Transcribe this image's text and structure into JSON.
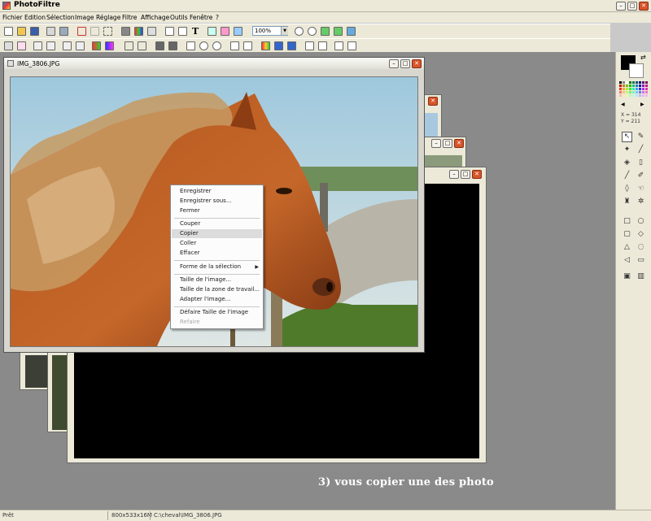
{
  "app": {
    "title": "PhotoFiltre"
  },
  "menu": [
    "Fichier",
    "Edition",
    "Sélection",
    "Image",
    "Réglage",
    "Filtre",
    "Affichage",
    "Outils",
    "Fenêtre",
    "?"
  ],
  "toolbar": {
    "zoom_value": "100%"
  },
  "document": {
    "title": "IMG_3806.JPG"
  },
  "context_menu": {
    "items": [
      {
        "label": "Enregistrer",
        "state": "normal"
      },
      {
        "label": "Enregistrer sous...",
        "state": "normal"
      },
      {
        "label": "Fermer",
        "state": "normal"
      },
      {
        "label": "Couper",
        "state": "normal"
      },
      {
        "label": "Copier",
        "state": "highlighted"
      },
      {
        "label": "Coller",
        "state": "normal"
      },
      {
        "label": "Effacer",
        "state": "normal"
      },
      {
        "label": "Forme de la sélection",
        "state": "submenu"
      },
      {
        "label": "Taille de l'image...",
        "state": "normal"
      },
      {
        "label": "Taille de la zone de travail...",
        "state": "normal"
      },
      {
        "label": "Adapter l'image...",
        "state": "normal"
      },
      {
        "label": "Défaire Taille de l'image",
        "state": "normal"
      },
      {
        "label": "Refaire",
        "state": "disabled"
      }
    ]
  },
  "tools_panel": {
    "coord_x": "X = 314",
    "coord_y": "Y = 211"
  },
  "status_bar": {
    "state": "Prêt",
    "size": "800x533x16M",
    "path": "C:\\cheval\\IMG_3806.JPG"
  },
  "caption": "3) vous copier une des photo",
  "colors": {
    "foreground": "#000000",
    "background": "#ffffff",
    "workspace": "#8a8a8a",
    "menu_highlight": "#dcdcdc"
  }
}
